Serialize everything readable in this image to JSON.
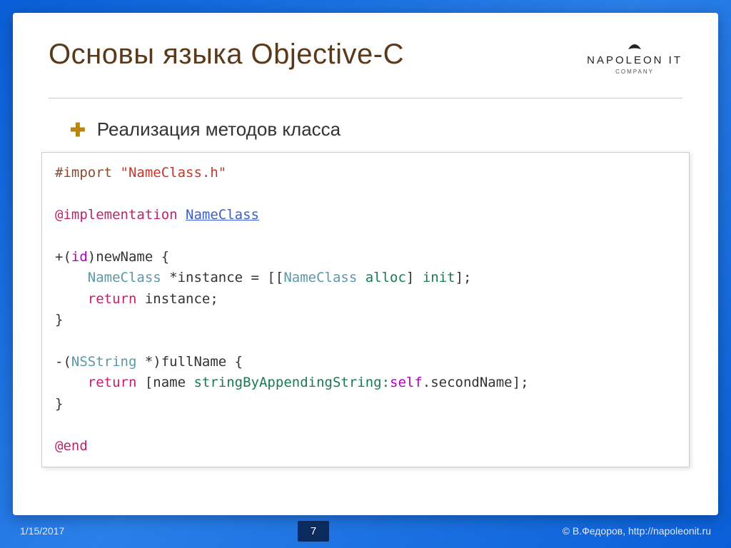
{
  "header": {
    "title": "Основы языка Objective-C",
    "logo": {
      "brand": "NAPOLEON IT",
      "sub": "COMPANY"
    }
  },
  "bullet": "Реализация методов класса",
  "code": {
    "tokens": [
      [
        {
          "t": "#import ",
          "c": "c-directive"
        },
        {
          "t": "\"NameClass.h\"",
          "c": "c-string"
        }
      ],
      [
        {
          "t": "",
          "c": ""
        }
      ],
      [
        {
          "t": "@implementation",
          "c": "c-keyword"
        },
        {
          "t": " ",
          "c": ""
        },
        {
          "t": "NameClass",
          "c": "c-link"
        }
      ],
      [
        {
          "t": "",
          "c": ""
        }
      ],
      [
        {
          "t": "+(",
          "c": ""
        },
        {
          "t": "id",
          "c": "c-builtin"
        },
        {
          "t": ")newName {",
          "c": ""
        }
      ],
      [
        {
          "t": "    ",
          "c": ""
        },
        {
          "t": "NameClass",
          "c": "c-type"
        },
        {
          "t": " *instance = [[",
          "c": ""
        },
        {
          "t": "NameClass",
          "c": "c-type"
        },
        {
          "t": " ",
          "c": ""
        },
        {
          "t": "alloc",
          "c": "c-method"
        },
        {
          "t": "] ",
          "c": ""
        },
        {
          "t": "init",
          "c": "c-method"
        },
        {
          "t": "];",
          "c": ""
        }
      ],
      [
        {
          "t": "    ",
          "c": ""
        },
        {
          "t": "return",
          "c": "c-keyword"
        },
        {
          "t": " instance;",
          "c": ""
        }
      ],
      [
        {
          "t": "}",
          "c": ""
        }
      ],
      [
        {
          "t": "",
          "c": ""
        }
      ],
      [
        {
          "t": "-(",
          "c": ""
        },
        {
          "t": "NSString",
          "c": "c-type"
        },
        {
          "t": " *)fullName {",
          "c": ""
        }
      ],
      [
        {
          "t": "    ",
          "c": ""
        },
        {
          "t": "return",
          "c": "c-keyword"
        },
        {
          "t": " [name ",
          "c": ""
        },
        {
          "t": "stringByAppendingString:",
          "c": "c-method"
        },
        {
          "t": "self",
          "c": "c-builtin"
        },
        {
          "t": ".secondName];",
          "c": ""
        }
      ],
      [
        {
          "t": "}",
          "c": ""
        }
      ],
      [
        {
          "t": "",
          "c": ""
        }
      ],
      [
        {
          "t": "@end",
          "c": "c-keyword"
        }
      ]
    ]
  },
  "footer": {
    "date": "1/15/2017",
    "page": "7",
    "copyright": "© В.Федоров, http://napoleonit.ru"
  }
}
